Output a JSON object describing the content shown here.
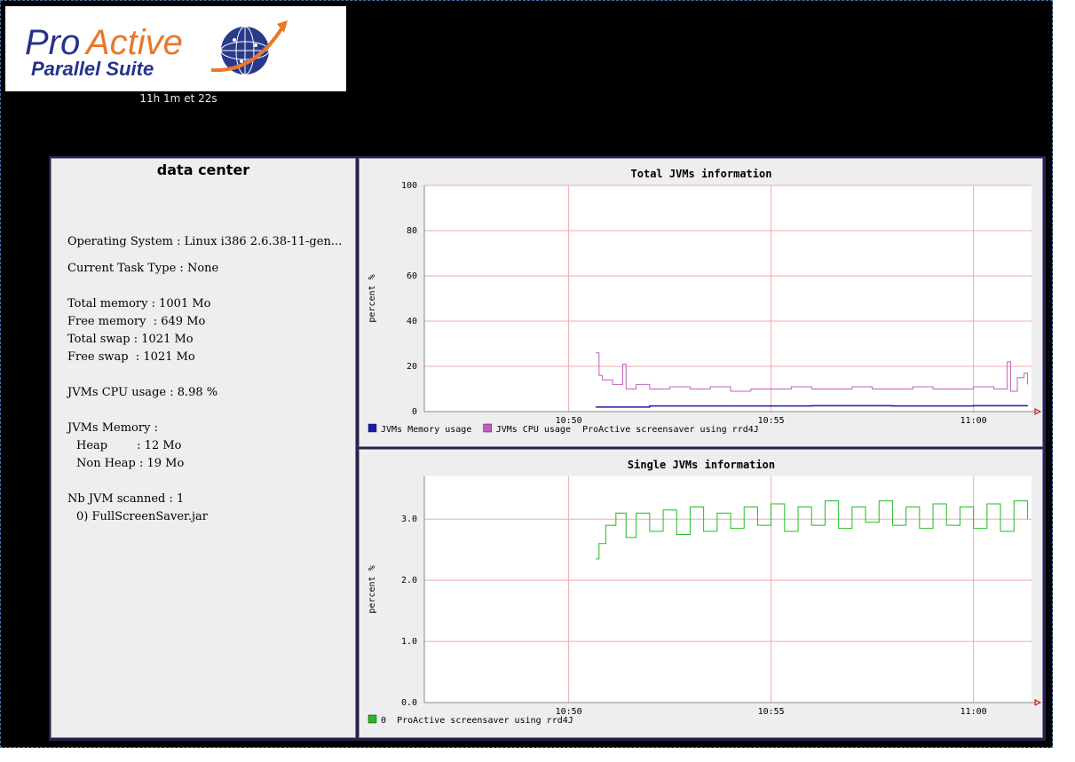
{
  "logo": {
    "brand_line1": "ProActive",
    "brand_line2": "Parallel Suite"
  },
  "timer": "11h 1m et 22s",
  "info": {
    "title": "data center",
    "os": "Operating System : Linux i386 2.6.38-11-gen...",
    "task_type": "Current Task Type : None",
    "total_memory": "Total memory : 1001 Mo",
    "free_memory": "Free memory  : 649 Mo",
    "total_swap": "Total swap : 1021 Mo",
    "free_swap": "Free swap  : 1021 Mo",
    "cpu_usage": "JVMs CPU usage : 8.98 %",
    "jvm_memory": "JVMs Memory :",
    "heap": "Heap        : 12 Mo",
    "non_heap": "Non Heap : 19 Mo",
    "nb_jvm": "Nb JVM scanned : 1",
    "jvm_item": "0) FullScreenSaver.jar"
  },
  "colors": {
    "memory_series": "#1a1aa8",
    "cpu_series": "#c060c0",
    "single_series": "#22bb22",
    "grid": "#f2aaaa",
    "panel": "#eeeeee"
  },
  "chart_data": [
    {
      "type": "line",
      "title": "Total JVMs information",
      "ylabel": "percent %",
      "xlabel": "",
      "ylim": [
        0,
        100
      ],
      "yticks": [
        "0",
        "20",
        "40",
        "60",
        "80",
        "100"
      ],
      "xtick_labels": [
        "10:50",
        "10:55",
        "11:00"
      ],
      "x_range": [
        "10:46:26",
        "11:01:26"
      ],
      "grid": true,
      "legend_placement": "bottom",
      "legend": [
        "JVMs Memory usage",
        "JVMs CPU usage"
      ],
      "footer": "ProActive screensaver using rrd4J",
      "series": [
        {
          "name": "JVMs Memory usage",
          "x": [
            "10:50:40",
            "10:52:00",
            "10:54:00",
            "10:56:00",
            "10:58:00",
            "11:00:00",
            "11:01:20"
          ],
          "values": [
            2.0,
            2.5,
            2.5,
            2.6,
            2.5,
            2.6,
            2.7
          ]
        },
        {
          "name": "JVMs CPU usage",
          "x": [
            "10:50:40",
            "10:50:45",
            "10:50:50",
            "10:51:05",
            "10:51:20",
            "10:51:25",
            "10:51:40",
            "10:52:00",
            "10:52:30",
            "10:53:00",
            "10:53:30",
            "10:54:00",
            "10:54:30",
            "10:55:00",
            "10:55:30",
            "10:56:00",
            "10:56:30",
            "10:57:00",
            "10:57:30",
            "10:58:00",
            "10:58:30",
            "10:59:00",
            "10:59:30",
            "11:00:00",
            "11:00:30",
            "11:00:50",
            "11:00:55",
            "11:01:05",
            "11:01:15",
            "11:01:20"
          ],
          "values": [
            26,
            16,
            14,
            12,
            21,
            10,
            12,
            10,
            11,
            10,
            11,
            9,
            10,
            10,
            11,
            10,
            10,
            11,
            10,
            10,
            11,
            10,
            10,
            11,
            10,
            22,
            9,
            15,
            17,
            12
          ]
        }
      ]
    },
    {
      "type": "line",
      "title": "Single JVMs information",
      "ylabel": "percent %",
      "xlabel": "",
      "ylim": [
        0,
        3.7
      ],
      "yticks": [
        "0.0",
        "1.0",
        "2.0",
        "3.0"
      ],
      "xtick_labels": [
        "10:50",
        "10:55",
        "11:00"
      ],
      "x_range": [
        "10:46:26",
        "11:01:26"
      ],
      "grid": true,
      "legend_placement": "bottom",
      "legend": [
        "0"
      ],
      "footer": "ProActive screensaver using rrd4J",
      "series": [
        {
          "name": "0",
          "x": [
            "10:50:40",
            "10:50:45",
            "10:50:55",
            "10:51:10",
            "10:51:25",
            "10:51:40",
            "10:52:00",
            "10:52:20",
            "10:52:40",
            "10:53:00",
            "10:53:20",
            "10:53:40",
            "10:54:00",
            "10:54:20",
            "10:54:40",
            "10:55:00",
            "10:55:20",
            "10:55:40",
            "10:56:00",
            "10:56:20",
            "10:56:40",
            "10:57:00",
            "10:57:20",
            "10:57:40",
            "10:58:00",
            "10:58:20",
            "10:58:40",
            "10:59:00",
            "10:59:20",
            "10:59:40",
            "11:00:00",
            "11:00:20",
            "11:00:40",
            "11:01:00",
            "11:01:20"
          ],
          "values": [
            2.35,
            2.6,
            2.9,
            3.1,
            2.7,
            3.1,
            2.8,
            3.15,
            2.75,
            3.2,
            2.8,
            3.1,
            2.85,
            3.2,
            2.9,
            3.25,
            2.8,
            3.2,
            2.9,
            3.3,
            2.85,
            3.2,
            2.95,
            3.3,
            2.9,
            3.2,
            2.85,
            3.25,
            2.9,
            3.2,
            2.85,
            3.25,
            2.8,
            3.3,
            3.0
          ]
        }
      ]
    }
  ]
}
